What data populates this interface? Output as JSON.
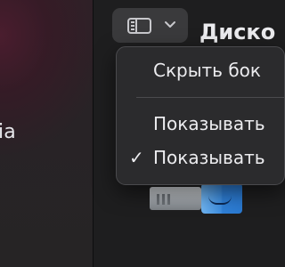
{
  "sidebar": {
    "partial_text": "ia"
  },
  "toolbar": {
    "sidebar_toggle_icon": "sidebar-toggle-icon",
    "dropdown_icon": "chevron-down-icon"
  },
  "window": {
    "title": "Диско"
  },
  "menu": {
    "items": [
      {
        "label": "Скрыть бок",
        "checked": false
      },
      {
        "label": "Показывать",
        "checked": false
      },
      {
        "label": "Показывать",
        "checked": true
      }
    ],
    "check_glyph": "✓"
  },
  "content": {
    "icons": [
      "disk-icon",
      "finder-icon"
    ]
  }
}
